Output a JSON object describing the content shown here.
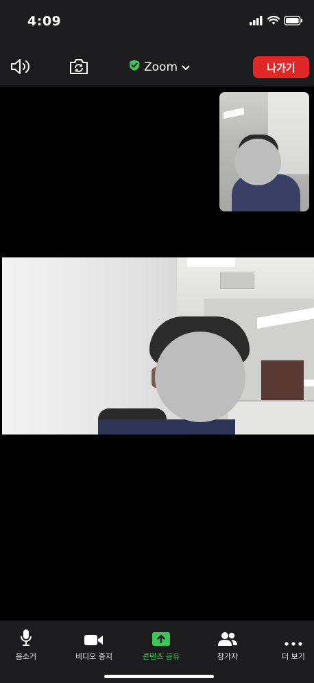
{
  "status_bar": {
    "time": "4:09",
    "signal_icon": "cellular-signal-icon",
    "wifi_icon": "wifi-icon",
    "battery_icon": "battery-icon"
  },
  "top_bar": {
    "speaker_icon": "speaker-icon",
    "camera_flip_icon": "camera-flip-icon",
    "security_icon": "shield-check-icon",
    "title": "Zoom",
    "dropdown_icon": "chevron-down-icon",
    "leave_label": "나가기",
    "leave_color": "#e02828",
    "security_color": "#3ec55a"
  },
  "bottom_bar": {
    "items": [
      {
        "label": "음소거",
        "icon": "microphone-icon"
      },
      {
        "label": "비디오 중지",
        "icon": "video-camera-icon"
      },
      {
        "label": "콘텐츠 공유",
        "icon": "share-upload-icon",
        "active": true
      },
      {
        "label": "참가자",
        "icon": "participants-icon"
      },
      {
        "label": "더 보기",
        "icon": "more-dots-icon"
      }
    ],
    "active_color": "#3ec55a"
  }
}
